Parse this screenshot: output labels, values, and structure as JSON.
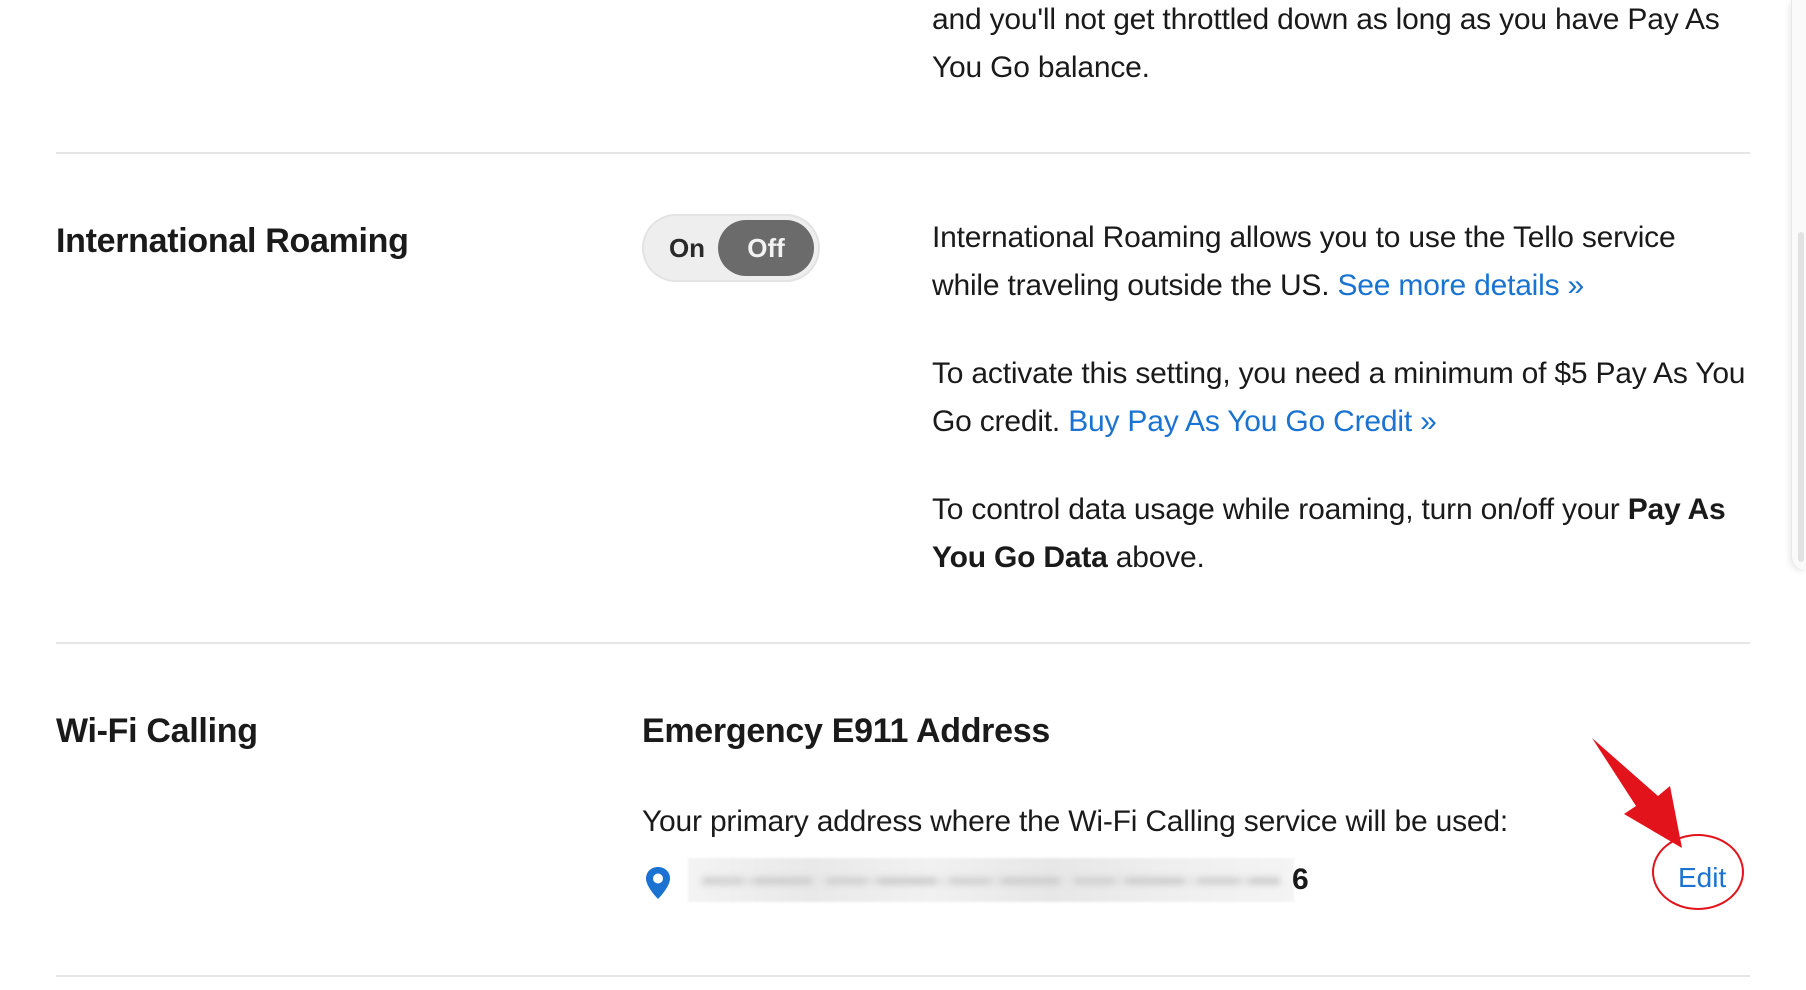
{
  "top_paragraph": {
    "line1": "and you'll not get throttled down as long as you have Pay As",
    "line2": "You Go balance."
  },
  "international_roaming": {
    "title": "International Roaming",
    "toggle": {
      "on_label": "On",
      "off_label": "Off",
      "selected": "Off"
    },
    "desc1_line1": "International Roaming allows you to use the Tello service",
    "desc1_line2_text": "while traveling outside the US.",
    "desc1_link": "See more details »",
    "desc2_line1": "To activate this setting, you need a minimum of $5 Pay As You",
    "desc2_line2_text": "Go credit.",
    "desc2_link": "Buy Pay As You Go Credit »",
    "desc3_line1_text": "To control data usage while roaming, turn on/off your",
    "desc3_bold1": "Pay As",
    "desc3_bold2": "You Go Data",
    "desc3_line2_text": "above."
  },
  "wifi_calling": {
    "title": "Wi-Fi Calling",
    "address_heading": "Emergency E911 Address",
    "address_intro": "Your primary address where the Wi-Fi Calling service will be used:",
    "address_visible_tail": "6",
    "edit_label": "Edit"
  },
  "colors": {
    "link": "#1a73d1",
    "annotation": "#e3131b",
    "toggle_selected": "#6b6b6b"
  },
  "icons": {
    "address": "location-pin-icon",
    "annotation": "red-arrow-icon"
  }
}
